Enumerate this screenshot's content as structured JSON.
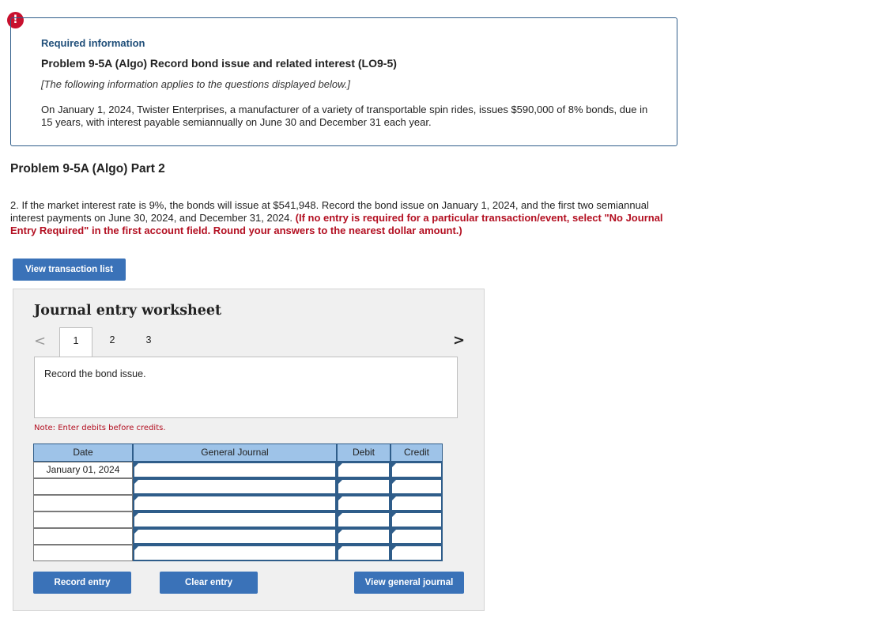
{
  "alert": {
    "icon": "alert-icon",
    "symbol": "!",
    "color": "#c8102e"
  },
  "info": {
    "required": "Required information",
    "title": "Problem 9-5A (Algo) Record bond issue and related interest (LO9-5)",
    "note": "[The following information applies to the questions displayed below.]",
    "body": "On January 1, 2024, Twister Enterprises, a manufacturer of a variety of transportable spin rides, issues $590,000 of 8% bonds, due in 15 years, with interest payable semiannually on June 30 and December 31 each year."
  },
  "part_title": "Problem 9-5A (Algo) Part 2",
  "question": {
    "text": "2. If the market interest rate is 9%, the bonds will issue at $541,948. Record the bond issue on January 1, 2024, and the first two semiannual interest payments on June 30, 2024, and December 31, 2024.",
    "instruction": "(If no entry is required for a particular transaction/event, select \"No Journal Entry Required\" in the first account field. Round your answers to the nearest dollar amount.)"
  },
  "buttons": {
    "view_transaction_list": "View transaction list",
    "record_entry": "Record entry",
    "clear_entry": "Clear entry",
    "view_general_journal": "View general journal"
  },
  "worksheet": {
    "title": "Journal entry worksheet",
    "prev_icon": "<",
    "next_icon": ">",
    "tabs": [
      "1",
      "2",
      "3"
    ],
    "active_tab": "1",
    "description": "Record the bond issue.",
    "note": "Note: Enter debits before credits.",
    "columns": {
      "date": "Date",
      "journal": "General Journal",
      "debit": "Debit",
      "credit": "Credit"
    },
    "rows": [
      {
        "date": "January 01, 2024",
        "account": "",
        "debit": "",
        "credit": ""
      },
      {
        "date": "",
        "account": "",
        "debit": "",
        "credit": ""
      },
      {
        "date": "",
        "account": "",
        "debit": "",
        "credit": ""
      },
      {
        "date": "",
        "account": "",
        "debit": "",
        "credit": ""
      },
      {
        "date": "",
        "account": "",
        "debit": "",
        "credit": ""
      },
      {
        "date": "",
        "account": "",
        "debit": "",
        "credit": ""
      }
    ]
  },
  "colors": {
    "accent": "#3a72b8",
    "header_fill": "#9ec3e8",
    "instruction_red": "#b30f21",
    "border_blue": "#2f5d8a"
  }
}
